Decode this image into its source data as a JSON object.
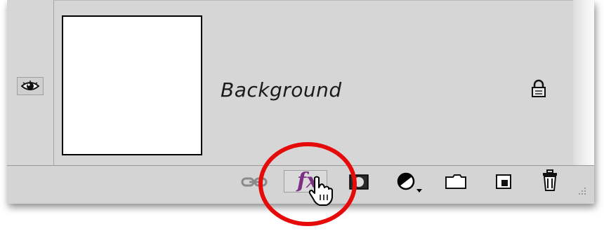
{
  "layers_panel": {
    "layers": [
      {
        "name": "Background",
        "visible": true,
        "locked": true
      }
    ]
  },
  "bottom_toolbar": {
    "icons": [
      "link-layers-icon",
      "add-layer-style-icon",
      "add-layer-mask-icon",
      "new-adjustment-layer-icon",
      "new-group-icon",
      "new-layer-icon",
      "delete-layer-icon"
    ],
    "fx_label": "fx"
  },
  "annotation": {
    "highlight_color": "#e60b0b",
    "fx_color": "#7d2f86"
  }
}
